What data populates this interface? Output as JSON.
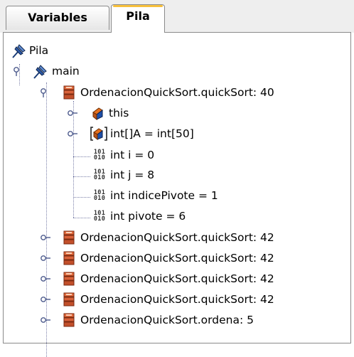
{
  "tabs": [
    {
      "label": "Variables",
      "active": false
    },
    {
      "label": "Pila",
      "active": true
    }
  ],
  "tree": {
    "root": {
      "label": "Pila",
      "icon": "pushpin-icon"
    },
    "thread": {
      "label": "main",
      "icon": "pushpin-icon"
    },
    "frames_expanded": {
      "label": "OrdenacionQuickSort.quickSort: 40",
      "icon": "stack-frame-icon",
      "children": [
        {
          "label": "this",
          "icon": "object-icon"
        },
        {
          "label": "int[]A = int[50]",
          "icon": "array-object-icon"
        },
        {
          "label": "int i = 0",
          "icon": "binary-icon",
          "binary_text": "101\n010"
        },
        {
          "label": "int j = 8",
          "icon": "binary-icon",
          "binary_text": "101\n010"
        },
        {
          "label": "int indicePivote = 1",
          "icon": "binary-icon",
          "binary_text": "101\n010"
        },
        {
          "label": "int pivote = 6",
          "icon": "binary-icon",
          "binary_text": "101\n010"
        }
      ]
    },
    "frames_collapsed": [
      {
        "label": "OrdenacionQuickSort.quickSort: 42"
      },
      {
        "label": "OrdenacionQuickSort.quickSort: 42"
      },
      {
        "label": "OrdenacionQuickSort.quickSort: 42"
      },
      {
        "label": "OrdenacionQuickSort.quickSort: 42"
      },
      {
        "label": "OrdenacionQuickSort.ordena: 5"
      }
    ]
  },
  "colors": {
    "tab_highlight": "#f8c03c",
    "tree_line": "#7a7fa8",
    "frame_icon": "#d9623a"
  }
}
